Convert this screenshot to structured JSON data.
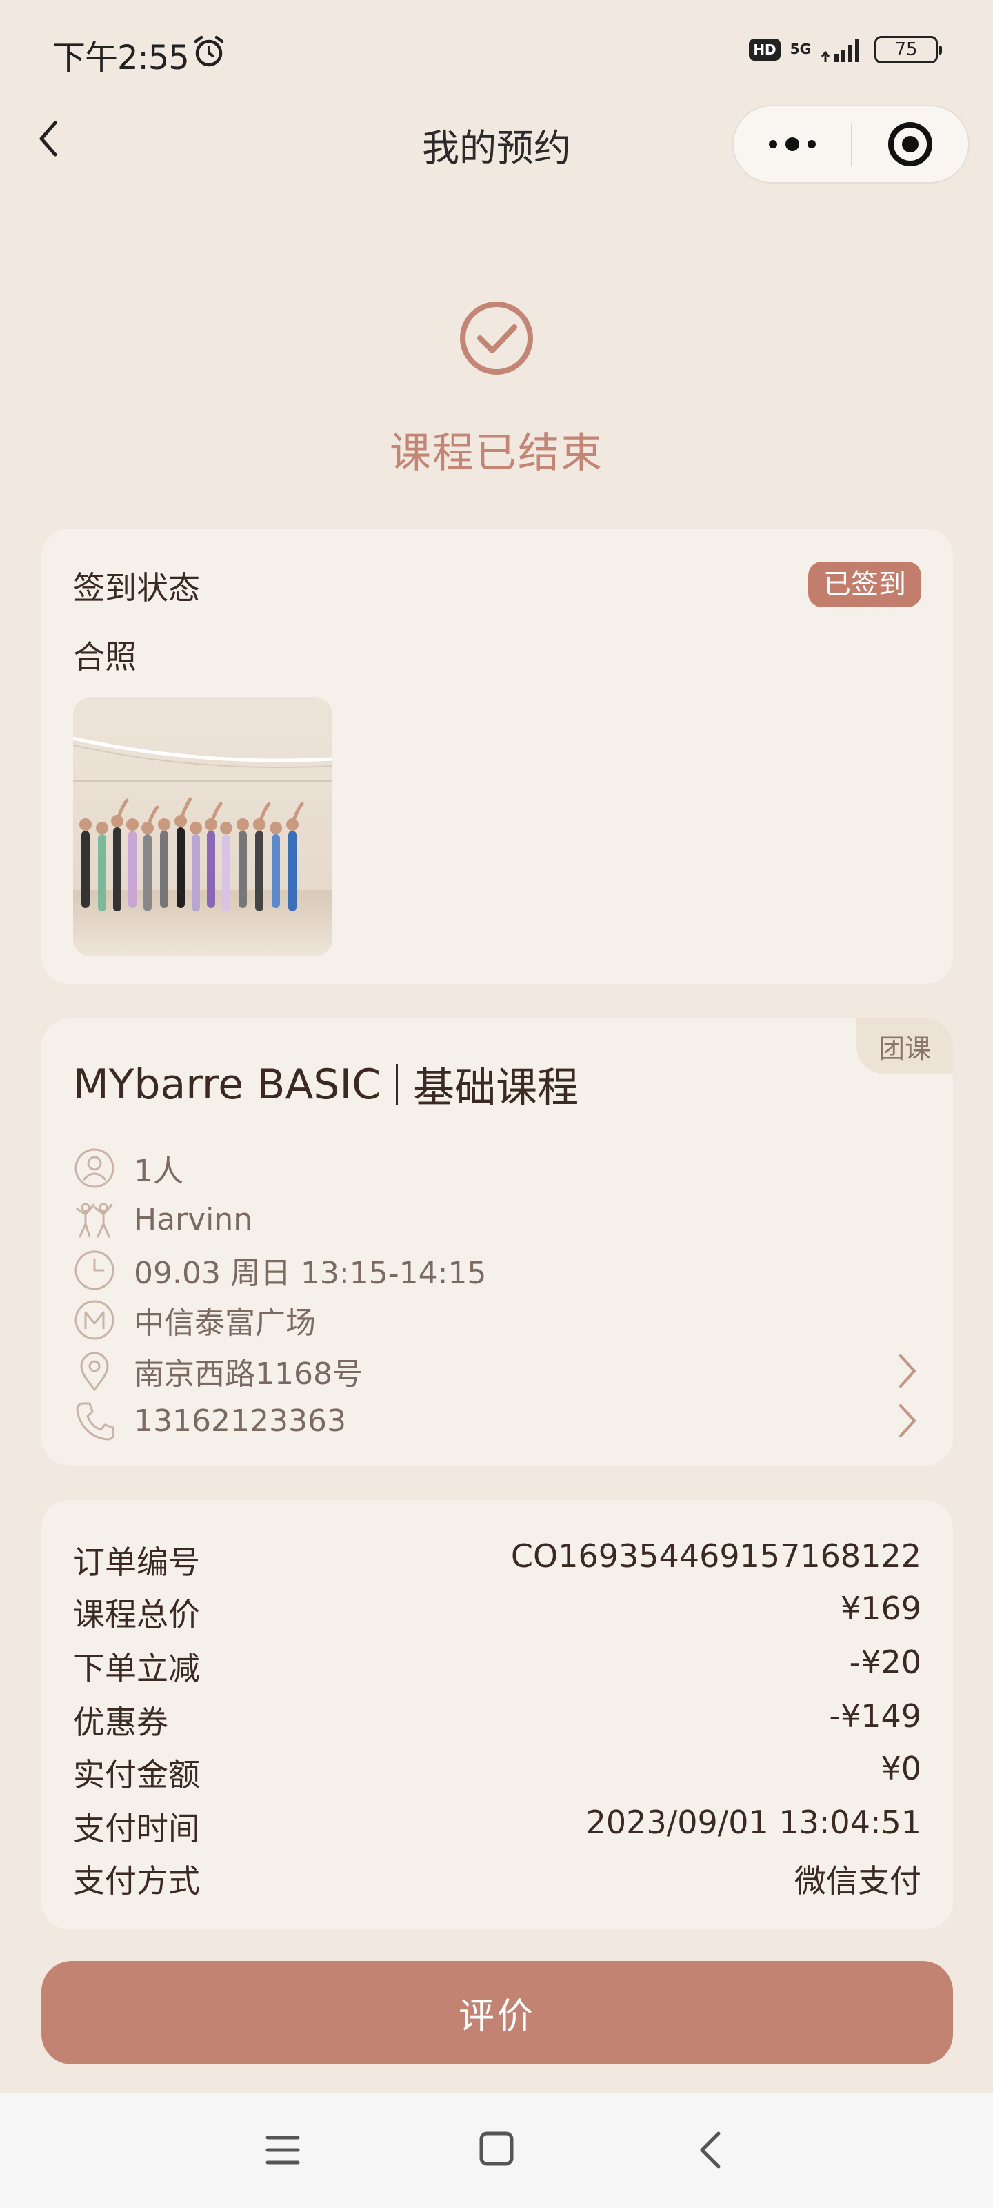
{
  "status_bar": {
    "time": "下午2:55",
    "hd": "HD",
    "network": "5G",
    "battery": "75"
  },
  "nav": {
    "title": "我的预约"
  },
  "status": {
    "text": "课程已结束"
  },
  "signin_card": {
    "label": "签到状态",
    "badge": "已签到",
    "photo_label": "合照"
  },
  "course_card": {
    "tag": "团课",
    "name_en": "MYbarre BASIC",
    "name_cn": "基础课程",
    "people": "1人",
    "instructor": "Harvinn",
    "time": "09.03 周日 13:15-14:15",
    "venue": "中信泰富广场",
    "address": "南京西路1168号",
    "phone": "13162123363"
  },
  "order": {
    "rows": [
      {
        "label": "订单编号",
        "value": "CO1693544691571 68122"
      },
      {
        "label": "课程总价",
        "value": "¥169"
      },
      {
        "label": "下单立减",
        "value": "-¥20"
      },
      {
        "label": "优惠券",
        "value": "-¥149"
      },
      {
        "label": "实付金额",
        "value": "¥0"
      },
      {
        "label": "支付时间",
        "value": "2023/09/01 13:04:51"
      },
      {
        "label": "支付方式",
        "value": "微信支付"
      }
    ]
  },
  "actions": {
    "review": "评价"
  },
  "colors": {
    "accent": "#C28372",
    "background": "#F1E8DF",
    "card": "#F6F0EA"
  }
}
